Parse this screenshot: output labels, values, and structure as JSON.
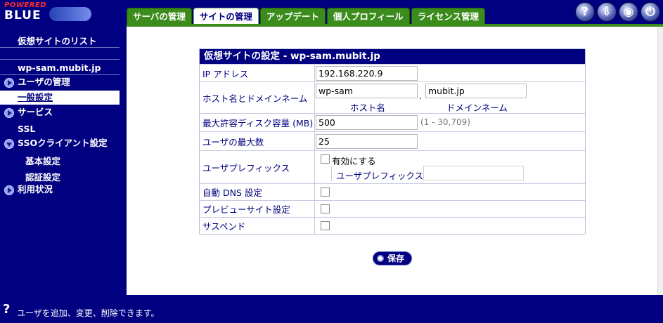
{
  "logo": {
    "powered": "POWERED",
    "name": "BLUE"
  },
  "tabs": [
    {
      "label": "サーバの管理"
    },
    {
      "label": "サイトの管理"
    },
    {
      "label": "アップデート"
    },
    {
      "label": "個人プロフィール"
    },
    {
      "label": "ライセンス管理"
    }
  ],
  "top_icons": {
    "help": "?",
    "update": "⇩",
    "view": "◉",
    "logout": "⏻"
  },
  "sidebar": {
    "list": "仮想サイトのリスト",
    "site": "wp-sam.mubit.jp",
    "user_mgmt": "ユーザの管理",
    "general": "一般設定",
    "service": "サービス",
    "ssl": "SSL",
    "sso": "SSOクライアント設定",
    "basic": "基本設定",
    "auth": "認証設定",
    "usage": "利用状況"
  },
  "form": {
    "title": "仮想サイトの設定 - wp-sam.mubit.jp",
    "ip_label": "IP アドレス",
    "ip_value": "192.168.220.9",
    "host_label": "ホスト名とドメインネーム",
    "host_value": "wp-sam",
    "dot": ".",
    "domain_value": "mubit.jp",
    "host_caption": "ホスト名",
    "domain_caption": "ドメインネーム",
    "disk_label": "最大許容ディスク容量 (MB)",
    "disk_value": "500",
    "disk_hint": "(1 - 30,709)",
    "users_label": "ユーザの最大数",
    "users_value": "25",
    "prefix_label": "ユーザプレフィックス",
    "prefix_enable": "有効にする",
    "prefix_field": "ユーザプレフィックス",
    "dns_label": "自動 DNS 設定",
    "preview_label": "プレビューサイト設定",
    "suspend_label": "サスペンド"
  },
  "save_label": "保存",
  "status": {
    "icon": "?",
    "message": "ユーザを追加、変更、削除できます。"
  }
}
